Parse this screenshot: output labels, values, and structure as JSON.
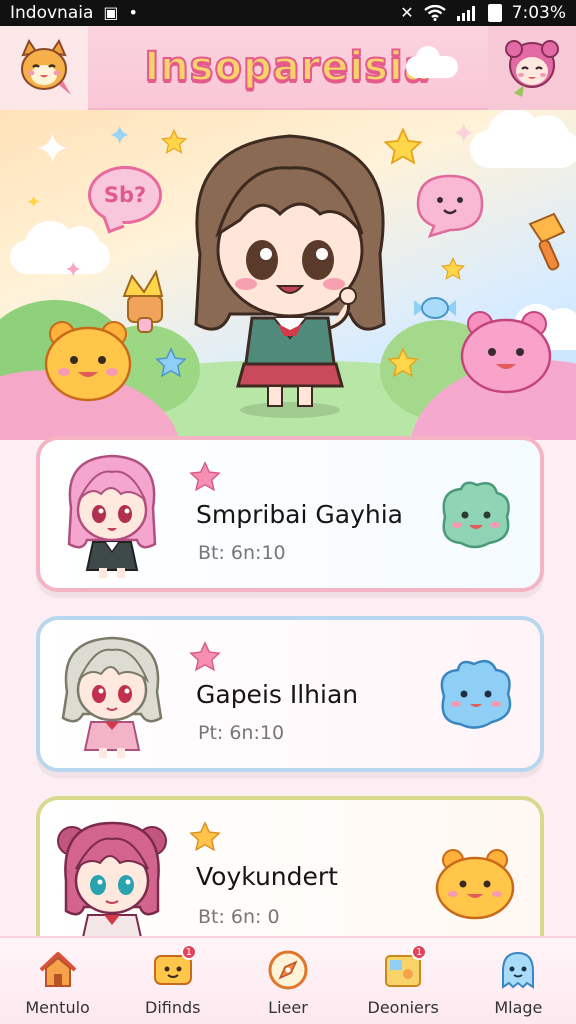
{
  "status_bar": {
    "carrier": "Indovnaia",
    "time": "7:03%"
  },
  "header": {
    "title": "Insopareisia"
  },
  "hero": {
    "speech_bubble_text": "Sb?"
  },
  "cards": [
    {
      "name": "Smpribai Gayhia",
      "subtitle": "Bt: 6n:10",
      "accent": "#f4b4c4"
    },
    {
      "name": "Gapeis Ilhian",
      "subtitle": "Pt: 6n:10",
      "accent": "#b8d7ef"
    },
    {
      "name": "Voykundert",
      "subtitle": "Bt: 6n: 0",
      "accent": "#d9d98e"
    }
  ],
  "bottom_nav": [
    {
      "label": "Mentulo",
      "icon": "home-icon"
    },
    {
      "label": "Difinds",
      "icon": "chat-icon",
      "badge": "1"
    },
    {
      "label": "Lieer",
      "icon": "compass-icon"
    },
    {
      "label": "Deoniers",
      "icon": "puzzle-icon",
      "badge": "1"
    },
    {
      "label": "Mlage",
      "icon": "ghost-icon"
    }
  ],
  "colors": {
    "pink_accent": "#e96a9c",
    "title_fill": "#f7d36a",
    "badge_red": "#e8425a"
  }
}
